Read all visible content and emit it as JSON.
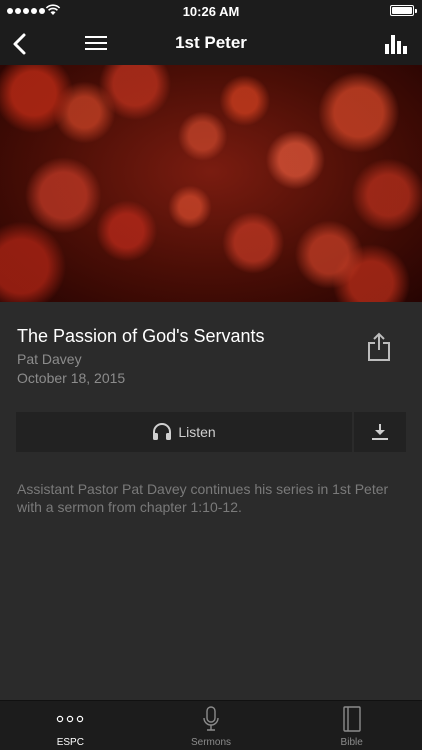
{
  "status_bar": {
    "time": "10:26 AM",
    "signal_bars": 5,
    "battery_level": 1.0
  },
  "nav": {
    "title": "1st Peter",
    "icons": [
      "back-chevron-icon",
      "hamburger-menu-icon",
      "bar-chart-icon"
    ]
  },
  "sermon": {
    "title": "The Passion of God's Servants",
    "speaker": "Pat Davey",
    "date": "October 18, 2015",
    "listen_label": "Listen",
    "description": "Assistant Pastor Pat Davey continues his series in 1st Peter with a sermon from chapter 1:10-12."
  },
  "tabs": [
    {
      "label": "ESPC",
      "icon": "ellipsis-icon",
      "active": true
    },
    {
      "label": "Sermons",
      "icon": "microphone-icon",
      "active": false
    },
    {
      "label": "Bible",
      "icon": "book-icon",
      "active": false
    }
  ],
  "colors": {
    "background": "#2b2b2b",
    "bar_background": "#1c1c1c",
    "button_background": "#222222",
    "muted_text": "#8c8c8c"
  }
}
